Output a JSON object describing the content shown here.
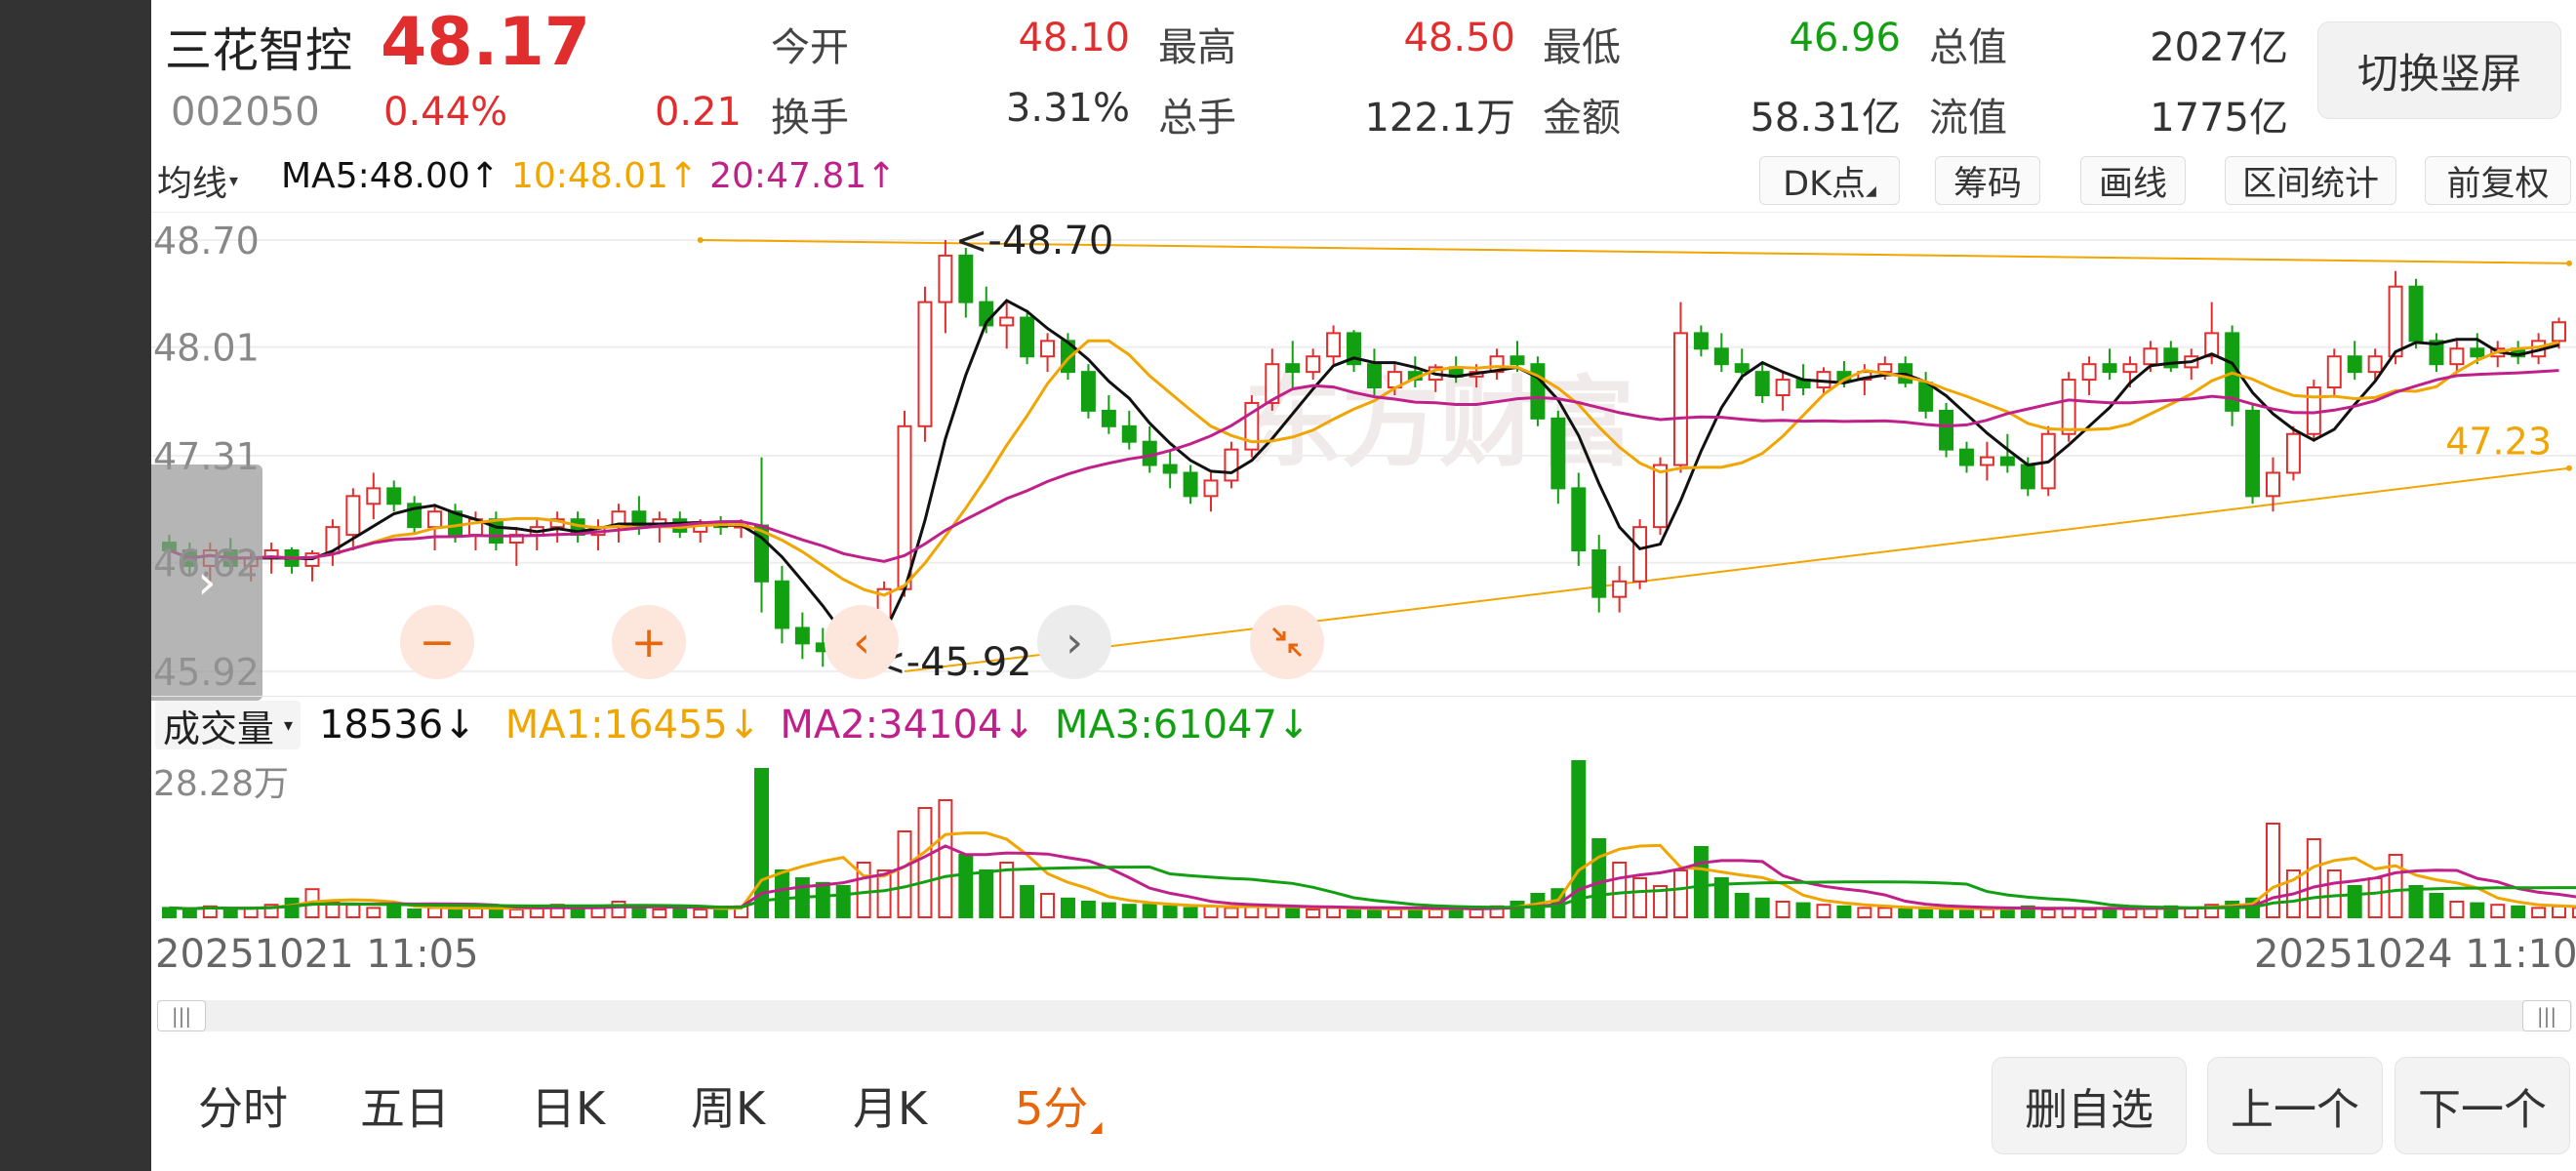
{
  "stock": {
    "name": "三花智控",
    "price": "48.17",
    "code": "002050",
    "change_pct": "0.44%",
    "change": "0.21"
  },
  "quote_stats": [
    {
      "label": "今开",
      "value": "48.10",
      "color": "#e02e2e"
    },
    {
      "label": "最高",
      "value": "48.50",
      "color": "#e02e2e"
    },
    {
      "label": "最低",
      "value": "46.96",
      "color": "#12a012"
    },
    {
      "label": "总值",
      "value": "2027亿",
      "color": "#333333"
    },
    {
      "label": "换手",
      "value": "3.31%",
      "color": "#333333"
    },
    {
      "label": "总手",
      "value": "122.1万",
      "color": "#333333"
    },
    {
      "label": "金额",
      "value": "58.31亿",
      "color": "#333333"
    },
    {
      "label": "流值",
      "value": "1775亿",
      "color": "#333333"
    }
  ],
  "toggle_label": "切换竖屏",
  "ma_bar": {
    "selector": "均线",
    "ma5": "MA5:48.00",
    "ma10": "10:48.01",
    "ma20": "20:47.81",
    "arrow_up": "↑"
  },
  "tools": {
    "dk": "DK点",
    "chips": "筹码",
    "draw": "画线",
    "range": "区间统计",
    "adjust": "前复权"
  },
  "price_axis": [
    "48.70",
    "48.01",
    "47.31",
    "46.62",
    "45.92"
  ],
  "annotations": {
    "high": "<-48.70",
    "low": "<-45.92",
    "trend_label": "47.23"
  },
  "watermark": "东方财富",
  "volume_bar": {
    "selector": "成交量",
    "current": "18536",
    "current_arrow": "↓",
    "ma1": "MA1:16455",
    "ma2": "MA2:34104",
    "ma3": "MA3:61047",
    "arrow_down": "↓",
    "max_label": "28.28万"
  },
  "time_range": {
    "start": "20251021 11:05",
    "end": "20251024 11:10"
  },
  "periods": [
    "分时",
    "五日",
    "日K",
    "周K",
    "月K",
    "5分"
  ],
  "active_period": "5分",
  "nav": {
    "remove": "删自选",
    "prev": "上一个",
    "next": "下一个"
  },
  "colors": {
    "up": "#e02e2e",
    "down": "#12a012",
    "ma5": "#111111",
    "ma10": "#f0a500",
    "ma20": "#c0208a",
    "vol_ma3": "#12a012",
    "accent": "#e8650a"
  },
  "chart_data": {
    "type": "candlestick",
    "x_range": [
      "20251021 11:05",
      "20251024 11:10"
    ],
    "y_range": [
      45.92,
      48.7
    ],
    "y_ticks": [
      48.7,
      48.01,
      47.31,
      46.62,
      45.92
    ],
    "high_marker": 48.7,
    "low_marker": 45.92,
    "trendline_value": 47.23,
    "candles": [
      {
        "o": 46.75,
        "h": 46.8,
        "l": 46.6,
        "c": 46.7
      },
      {
        "o": 46.7,
        "h": 46.75,
        "l": 46.55,
        "c": 46.6
      },
      {
        "o": 46.6,
        "h": 46.75,
        "l": 46.5,
        "c": 46.7
      },
      {
        "o": 46.7,
        "h": 46.78,
        "l": 46.55,
        "c": 46.6
      },
      {
        "o": 46.6,
        "h": 46.7,
        "l": 46.5,
        "c": 46.65
      },
      {
        "o": 46.65,
        "h": 46.75,
        "l": 46.55,
        "c": 46.7
      },
      {
        "o": 46.7,
        "h": 46.72,
        "l": 46.55,
        "c": 46.6
      },
      {
        "o": 46.6,
        "h": 46.7,
        "l": 46.5,
        "c": 46.68
      },
      {
        "o": 46.68,
        "h": 46.9,
        "l": 46.6,
        "c": 46.85
      },
      {
        "o": 46.8,
        "h": 47.1,
        "l": 46.7,
        "c": 47.05
      },
      {
        "o": 47.0,
        "h": 47.2,
        "l": 46.9,
        "c": 47.1
      },
      {
        "o": 47.1,
        "h": 47.15,
        "l": 46.95,
        "c": 47.0
      },
      {
        "o": 47.0,
        "h": 47.05,
        "l": 46.8,
        "c": 46.85
      },
      {
        "o": 46.85,
        "h": 47.0,
        "l": 46.7,
        "c": 46.95
      },
      {
        "o": 46.95,
        "h": 47.0,
        "l": 46.75,
        "c": 46.8
      },
      {
        "o": 46.8,
        "h": 46.95,
        "l": 46.7,
        "c": 46.9
      },
      {
        "o": 46.9,
        "h": 46.95,
        "l": 46.7,
        "c": 46.75
      },
      {
        "o": 46.75,
        "h": 46.85,
        "l": 46.6,
        "c": 46.8
      },
      {
        "o": 46.8,
        "h": 46.9,
        "l": 46.7,
        "c": 46.85
      },
      {
        "o": 46.85,
        "h": 46.95,
        "l": 46.75,
        "c": 46.9
      },
      {
        "o": 46.9,
        "h": 46.95,
        "l": 46.75,
        "c": 46.8
      },
      {
        "o": 46.8,
        "h": 46.9,
        "l": 46.7,
        "c": 46.85
      },
      {
        "o": 46.85,
        "h": 47.0,
        "l": 46.75,
        "c": 46.95
      },
      {
        "o": 46.95,
        "h": 47.05,
        "l": 46.8,
        "c": 46.85
      },
      {
        "o": 46.85,
        "h": 46.95,
        "l": 46.75,
        "c": 46.9
      },
      {
        "o": 46.9,
        "h": 46.95,
        "l": 46.78,
        "c": 46.82
      },
      {
        "o": 46.82,
        "h": 46.9,
        "l": 46.75,
        "c": 46.88
      },
      {
        "o": 46.88,
        "h": 46.92,
        "l": 46.8,
        "c": 46.85
      },
      {
        "o": 46.85,
        "h": 46.9,
        "l": 46.78,
        "c": 46.86
      },
      {
        "o": 46.86,
        "h": 47.3,
        "l": 46.3,
        "c": 46.5
      },
      {
        "o": 46.5,
        "h": 46.6,
        "l": 46.1,
        "c": 46.2
      },
      {
        "o": 46.2,
        "h": 46.3,
        "l": 46.0,
        "c": 46.1
      },
      {
        "o": 46.1,
        "h": 46.2,
        "l": 45.95,
        "c": 46.05
      },
      {
        "o": 46.05,
        "h": 46.1,
        "l": 45.93,
        "c": 45.97
      },
      {
        "o": 45.97,
        "h": 46.3,
        "l": 45.92,
        "c": 46.25
      },
      {
        "o": 46.25,
        "h": 46.5,
        "l": 46.2,
        "c": 46.45
      },
      {
        "o": 46.45,
        "h": 47.6,
        "l": 46.4,
        "c": 47.5
      },
      {
        "o": 47.5,
        "h": 48.4,
        "l": 47.4,
        "c": 48.3
      },
      {
        "o": 48.3,
        "h": 48.7,
        "l": 48.1,
        "c": 48.6
      },
      {
        "o": 48.6,
        "h": 48.65,
        "l": 48.2,
        "c": 48.3
      },
      {
        "o": 48.3,
        "h": 48.4,
        "l": 48.1,
        "c": 48.15
      },
      {
        "o": 48.15,
        "h": 48.3,
        "l": 48.0,
        "c": 48.2
      },
      {
        "o": 48.2,
        "h": 48.25,
        "l": 47.9,
        "c": 47.95
      },
      {
        "o": 47.95,
        "h": 48.1,
        "l": 47.85,
        "c": 48.05
      },
      {
        "o": 48.05,
        "h": 48.1,
        "l": 47.8,
        "c": 47.85
      },
      {
        "o": 47.85,
        "h": 47.9,
        "l": 47.55,
        "c": 47.6
      },
      {
        "o": 47.6,
        "h": 47.7,
        "l": 47.45,
        "c": 47.5
      },
      {
        "o": 47.5,
        "h": 47.6,
        "l": 47.35,
        "c": 47.4
      },
      {
        "o": 47.4,
        "h": 47.5,
        "l": 47.2,
        "c": 47.25
      },
      {
        "o": 47.25,
        "h": 47.35,
        "l": 47.1,
        "c": 47.2
      },
      {
        "o": 47.2,
        "h": 47.25,
        "l": 47.0,
        "c": 47.05
      },
      {
        "o": 47.05,
        "h": 47.2,
        "l": 46.95,
        "c": 47.15
      },
      {
        "o": 47.15,
        "h": 47.4,
        "l": 47.1,
        "c": 47.35
      },
      {
        "o": 47.35,
        "h": 47.7,
        "l": 47.3,
        "c": 47.65
      },
      {
        "o": 47.65,
        "h": 48.0,
        "l": 47.6,
        "c": 47.9
      },
      {
        "o": 47.9,
        "h": 48.05,
        "l": 47.75,
        "c": 47.85
      },
      {
        "o": 47.85,
        "h": 48.0,
        "l": 47.8,
        "c": 47.95
      },
      {
        "o": 47.95,
        "h": 48.15,
        "l": 47.9,
        "c": 48.1
      },
      {
        "o": 48.1,
        "h": 48.12,
        "l": 47.85,
        "c": 47.9
      },
      {
        "o": 47.9,
        "h": 48.0,
        "l": 47.7,
        "c": 47.75
      },
      {
        "o": 47.75,
        "h": 47.9,
        "l": 47.7,
        "c": 47.85
      },
      {
        "o": 47.85,
        "h": 47.95,
        "l": 47.75,
        "c": 47.8
      },
      {
        "o": 47.8,
        "h": 47.9,
        "l": 47.72,
        "c": 47.88
      },
      {
        "o": 47.88,
        "h": 47.95,
        "l": 47.78,
        "c": 47.82
      },
      {
        "o": 47.82,
        "h": 47.9,
        "l": 47.75,
        "c": 47.85
      },
      {
        "o": 47.85,
        "h": 48.0,
        "l": 47.8,
        "c": 47.95
      },
      {
        "o": 47.95,
        "h": 48.05,
        "l": 47.85,
        "c": 47.9
      },
      {
        "o": 47.9,
        "h": 47.95,
        "l": 47.5,
        "c": 47.55
      },
      {
        "o": 47.55,
        "h": 47.6,
        "l": 47.0,
        "c": 47.1
      },
      {
        "o": 47.1,
        "h": 47.2,
        "l": 46.6,
        "c": 46.7
      },
      {
        "o": 46.7,
        "h": 46.8,
        "l": 46.3,
        "c": 46.4
      },
      {
        "o": 46.4,
        "h": 46.6,
        "l": 46.3,
        "c": 46.5
      },
      {
        "o": 46.5,
        "h": 46.9,
        "l": 46.45,
        "c": 46.85
      },
      {
        "o": 46.85,
        "h": 47.3,
        "l": 46.8,
        "c": 47.25
      },
      {
        "o": 47.25,
        "h": 48.3,
        "l": 47.2,
        "c": 48.1
      },
      {
        "o": 48.1,
        "h": 48.15,
        "l": 47.95,
        "c": 48.0
      },
      {
        "o": 48.0,
        "h": 48.1,
        "l": 47.85,
        "c": 47.9
      },
      {
        "o": 47.9,
        "h": 48.0,
        "l": 47.8,
        "c": 47.85
      },
      {
        "o": 47.85,
        "h": 47.9,
        "l": 47.65,
        "c": 47.7
      },
      {
        "o": 47.7,
        "h": 47.85,
        "l": 47.6,
        "c": 47.8
      },
      {
        "o": 47.8,
        "h": 47.9,
        "l": 47.7,
        "c": 47.75
      },
      {
        "o": 47.75,
        "h": 47.88,
        "l": 47.7,
        "c": 47.85
      },
      {
        "o": 47.85,
        "h": 47.92,
        "l": 47.75,
        "c": 47.8
      },
      {
        "o": 47.8,
        "h": 47.9,
        "l": 47.7,
        "c": 47.85
      },
      {
        "o": 47.85,
        "h": 47.95,
        "l": 47.8,
        "c": 47.9
      },
      {
        "o": 47.9,
        "h": 47.95,
        "l": 47.75,
        "c": 47.78
      },
      {
        "o": 47.78,
        "h": 47.85,
        "l": 47.55,
        "c": 47.6
      },
      {
        "o": 47.6,
        "h": 47.65,
        "l": 47.3,
        "c": 47.35
      },
      {
        "o": 47.35,
        "h": 47.4,
        "l": 47.2,
        "c": 47.25
      },
      {
        "o": 47.25,
        "h": 47.4,
        "l": 47.15,
        "c": 47.3
      },
      {
        "o": 47.3,
        "h": 47.45,
        "l": 47.2,
        "c": 47.25
      },
      {
        "o": 47.25,
        "h": 47.3,
        "l": 47.05,
        "c": 47.1
      },
      {
        "o": 47.1,
        "h": 47.5,
        "l": 47.05,
        "c": 47.45
      },
      {
        "o": 47.45,
        "h": 47.85,
        "l": 47.4,
        "c": 47.8
      },
      {
        "o": 47.8,
        "h": 47.95,
        "l": 47.7,
        "c": 47.9
      },
      {
        "o": 47.9,
        "h": 48.0,
        "l": 47.8,
        "c": 47.85
      },
      {
        "o": 47.85,
        "h": 47.95,
        "l": 47.75,
        "c": 47.9
      },
      {
        "o": 47.9,
        "h": 48.05,
        "l": 47.85,
        "c": 48.0
      },
      {
        "o": 48.0,
        "h": 48.05,
        "l": 47.85,
        "c": 47.88
      },
      {
        "o": 47.88,
        "h": 48.0,
        "l": 47.8,
        "c": 47.95
      },
      {
        "o": 47.95,
        "h": 48.3,
        "l": 47.9,
        "c": 48.1
      },
      {
        "o": 48.1,
        "h": 48.15,
        "l": 47.5,
        "c": 47.6
      },
      {
        "o": 47.6,
        "h": 47.65,
        "l": 47.0,
        "c": 47.05
      },
      {
        "o": 47.05,
        "h": 47.3,
        "l": 46.95,
        "c": 47.2
      },
      {
        "o": 47.2,
        "h": 47.5,
        "l": 47.15,
        "c": 47.45
      },
      {
        "o": 47.45,
        "h": 47.8,
        "l": 47.4,
        "c": 47.75
      },
      {
        "o": 47.75,
        "h": 48.0,
        "l": 47.7,
        "c": 47.95
      },
      {
        "o": 47.95,
        "h": 48.05,
        "l": 47.8,
        "c": 47.85
      },
      {
        "o": 47.85,
        "h": 48.0,
        "l": 47.8,
        "c": 47.95
      },
      {
        "o": 47.95,
        "h": 48.5,
        "l": 47.9,
        "c": 48.4
      },
      {
        "o": 48.4,
        "h": 48.45,
        "l": 48.0,
        "c": 48.05
      },
      {
        "o": 48.05,
        "h": 48.1,
        "l": 47.85,
        "c": 47.9
      },
      {
        "o": 47.9,
        "h": 48.05,
        "l": 47.85,
        "c": 48.0
      },
      {
        "o": 48.0,
        "h": 48.1,
        "l": 47.9,
        "c": 47.95
      },
      {
        "o": 47.95,
        "h": 48.05,
        "l": 47.88,
        "c": 48.0
      },
      {
        "o": 48.0,
        "h": 48.05,
        "l": 47.9,
        "c": 47.95
      },
      {
        "o": 47.95,
        "h": 48.1,
        "l": 47.9,
        "c": 48.05
      },
      {
        "o": 48.05,
        "h": 48.2,
        "l": 48.0,
        "c": 48.17
      }
    ],
    "volume": {
      "max_label": "28.28万",
      "current": 18536,
      "ma1": 16455,
      "ma2": 34104,
      "ma3": 61047,
      "bars": [
        0.06,
        0.05,
        0.07,
        0.05,
        0.06,
        0.08,
        0.12,
        0.18,
        0.1,
        0.08,
        0.06,
        0.07,
        0.05,
        0.06,
        0.05,
        0.07,
        0.06,
        0.05,
        0.06,
        0.08,
        0.06,
        0.07,
        0.1,
        0.06,
        0.05,
        0.06,
        0.05,
        0.06,
        0.07,
        0.95,
        0.3,
        0.25,
        0.22,
        0.2,
        0.35,
        0.3,
        0.55,
        0.7,
        0.75,
        0.4,
        0.3,
        0.35,
        0.2,
        0.15,
        0.12,
        0.1,
        0.09,
        0.08,
        0.08,
        0.07,
        0.06,
        0.07,
        0.06,
        0.08,
        0.07,
        0.06,
        0.05,
        0.06,
        0.05,
        0.06,
        0.05,
        0.06,
        0.05,
        0.06,
        0.05,
        0.07,
        0.1,
        0.15,
        0.18,
        1.0,
        0.5,
        0.35,
        0.25,
        0.2,
        0.3,
        0.45,
        0.25,
        0.15,
        0.12,
        0.1,
        0.09,
        0.08,
        0.07,
        0.06,
        0.06,
        0.05,
        0.06,
        0.05,
        0.06,
        0.05,
        0.06,
        0.07,
        0.05,
        0.06,
        0.05,
        0.06,
        0.05,
        0.06,
        0.07,
        0.06,
        0.08,
        0.1,
        0.12,
        0.6,
        0.3,
        0.5,
        0.3,
        0.2,
        0.25,
        0.4,
        0.2,
        0.15,
        0.1,
        0.09,
        0.08,
        0.07,
        0.06,
        0.07,
        0.06,
        0.06
      ]
    }
  }
}
